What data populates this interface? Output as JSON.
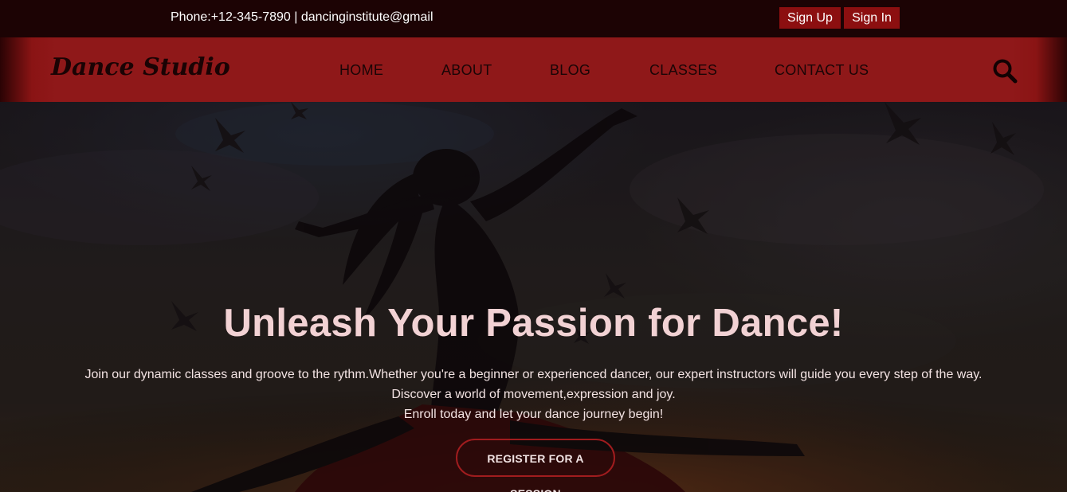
{
  "topbar": {
    "contact": "Phone:+12-345-7890 | dancinginstitute@gmail",
    "signup_label": "Sign Up",
    "signin_label": "Sign In"
  },
  "navbar": {
    "logo": "Dance Studio",
    "links": [
      "HOME",
      "ABOUT",
      "BLOG",
      "CLASSES",
      "CONTACT US"
    ],
    "search_icon": "search-icon"
  },
  "hero": {
    "title": "Unleash Your Passion for Dance!",
    "lines": [
      "Join our dynamic classes and groove to the rythm.Whether you're a beginner or experienced dancer, our expert instructors will guide you every step of the way.",
      "Discover a world of movement,expression and joy.",
      "Enroll today and let your dance journey begin!"
    ],
    "cta_label": "REGISTER FOR A SESSION"
  },
  "colors": {
    "topbar_bg": "#1c0304",
    "navbar_bg": "#8f1819",
    "button_bg": "#8c0f10",
    "title_color": "#f2d2d4",
    "cta_border": "#a01c1e"
  }
}
